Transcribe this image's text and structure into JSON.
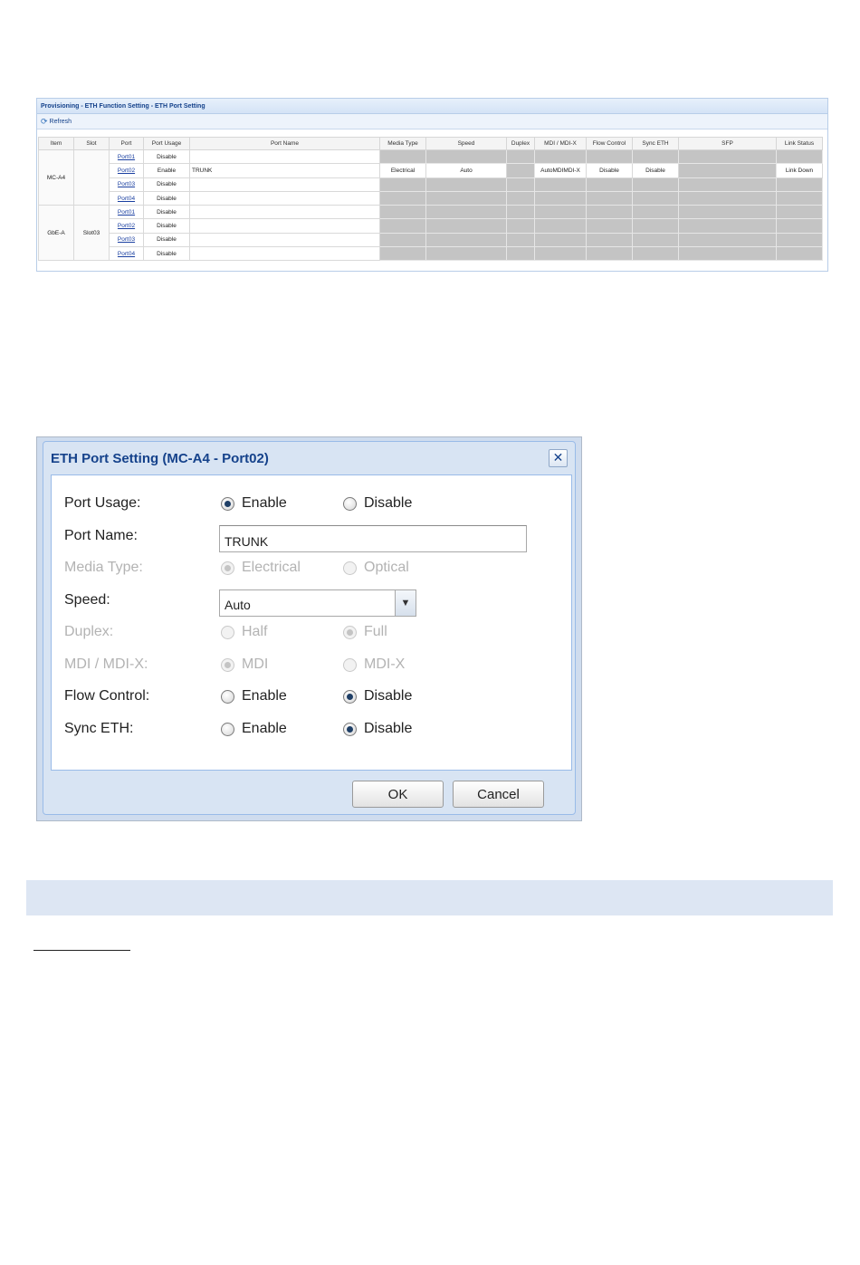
{
  "grid": {
    "breadcrumb": "Provisioning - ETH Function Setting - ETH Port Setting",
    "toolbar": {
      "refresh_label": "Refresh"
    },
    "columns": [
      "Item",
      "Slot",
      "Port",
      "Port Usage",
      "Port Name",
      "Media Type",
      "Speed",
      "Duplex",
      "MDI / MDI-X",
      "Flow Control",
      "Sync ETH",
      "SFP",
      "Link Status"
    ],
    "groups": [
      {
        "item": "MC-A4",
        "slot": ""
      },
      {
        "item": "GbE-A",
        "slot": "Slot03"
      }
    ],
    "rows": [
      {
        "port": "Port01",
        "usage": "Disable",
        "name": "",
        "media": "",
        "speed": "",
        "duplex": "",
        "mdi": "",
        "flow": "",
        "sync": "",
        "sfp": "",
        "link": ""
      },
      {
        "port": "Port02",
        "usage": "Enable",
        "name": "TRUNK",
        "media": "Electrical",
        "speed": "Auto",
        "duplex": "",
        "mdi": "AutoMDIMDI-X",
        "flow": "Disable",
        "sync": "Disable",
        "sfp": "",
        "link": "Link Down"
      },
      {
        "port": "Port03",
        "usage": "Disable",
        "name": "",
        "media": "",
        "speed": "",
        "duplex": "",
        "mdi": "",
        "flow": "",
        "sync": "",
        "sfp": "",
        "link": ""
      },
      {
        "port": "Port04",
        "usage": "Disable",
        "name": "",
        "media": "",
        "speed": "",
        "duplex": "",
        "mdi": "",
        "flow": "",
        "sync": "",
        "sfp": "",
        "link": ""
      },
      {
        "port": "Port01",
        "usage": "Disable",
        "name": "",
        "media": "",
        "speed": "",
        "duplex": "",
        "mdi": "",
        "flow": "",
        "sync": "",
        "sfp": "",
        "link": ""
      },
      {
        "port": "Port02",
        "usage": "Disable",
        "name": "",
        "media": "",
        "speed": "",
        "duplex": "",
        "mdi": "",
        "flow": "",
        "sync": "",
        "sfp": "",
        "link": ""
      },
      {
        "port": "Port03",
        "usage": "Disable",
        "name": "",
        "media": "",
        "speed": "",
        "duplex": "",
        "mdi": "",
        "flow": "",
        "sync": "",
        "sfp": "",
        "link": ""
      },
      {
        "port": "Port04",
        "usage": "Disable",
        "name": "",
        "media": "",
        "speed": "",
        "duplex": "",
        "mdi": "",
        "flow": "",
        "sync": "",
        "sfp": "",
        "link": ""
      }
    ]
  },
  "dialog": {
    "title": "ETH Port Setting (MC-A4 - Port02)",
    "port_usage": {
      "label": "Port Usage:",
      "opt1": "Enable",
      "opt2": "Disable",
      "selected": "opt1"
    },
    "port_name": {
      "label": "Port Name:",
      "value": "TRUNK"
    },
    "media_type": {
      "label": "Media Type:",
      "opt1": "Electrical",
      "opt2": "Optical",
      "selected": "opt1",
      "disabled": true
    },
    "speed": {
      "label": "Speed:",
      "value": "Auto"
    },
    "duplex": {
      "label": "Duplex:",
      "opt1": "Half",
      "opt2": "Full",
      "selected": "opt2",
      "disabled": true
    },
    "mdi": {
      "label": "MDI / MDI-X:",
      "opt1": "MDI",
      "opt2": "MDI-X",
      "selected": "opt1",
      "disabled": true
    },
    "flow_control": {
      "label": "Flow Control:",
      "opt1": "Enable",
      "opt2": "Disable",
      "selected": "opt2"
    },
    "sync_eth": {
      "label": "Sync ETH:",
      "opt1": "Enable",
      "opt2": "Disable",
      "selected": "opt2"
    },
    "ok_label": "OK",
    "cancel_label": "Cancel"
  },
  "colors": {
    "title_blue": "#15428b",
    "disabled_cell": "#c4c4c4",
    "section_bar": "#dde6f3"
  }
}
